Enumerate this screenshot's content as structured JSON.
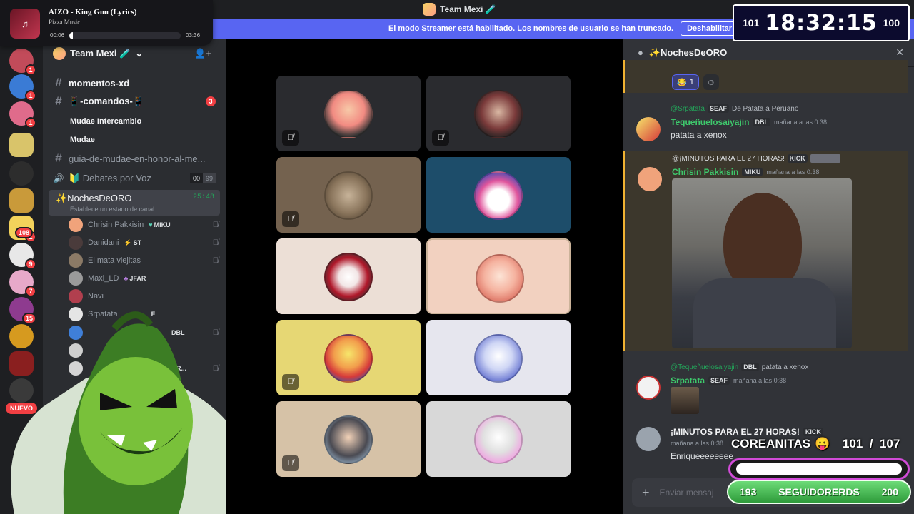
{
  "window": {
    "server_title": "Team Mexi 🧪"
  },
  "banner": {
    "text": "El modo Streamer está habilitado. Los nombres de usuario se han truncado.",
    "button": "Deshabilitar"
  },
  "rail": {
    "badges": [
      "1",
      "1",
      "1",
      "1",
      "108",
      "9",
      "7",
      "15"
    ],
    "new_label": "NUEVO"
  },
  "sidebar": {
    "server_name": "Team Mexi 🧪",
    "channels": [
      {
        "name": "momentos-xd"
      },
      {
        "name": "📱-comandos-📱",
        "count": "3"
      },
      {
        "name": "Mudae Intercambio"
      },
      {
        "name": "Mudae"
      },
      {
        "name": "guia-de-mudae-en-honor-al-me..."
      },
      {
        "name": "🔰 Debates por Voz",
        "count_a": "00",
        "count_b": "99"
      }
    ],
    "active_voice": {
      "name": "✨NochesDeORO",
      "timer": "25:48",
      "status": "Establece un estado de canal"
    },
    "members": [
      {
        "name": "Chrisin Pakkisin",
        "tag": "MIKU"
      },
      {
        "name": "Danidani",
        "tag": "ST"
      },
      {
        "name": "El mata viejitas",
        "tag": ""
      },
      {
        "name": "Maxi_LD",
        "tag": "JFAR"
      },
      {
        "name": "Navi",
        "tag": ""
      },
      {
        "name": "Srpatata",
        "tag": "F"
      },
      {
        "name": "",
        "tag": "DBL"
      },
      {
        "name": "",
        "tag": ""
      },
      {
        "name": "",
        "tag": "OR..."
      }
    ]
  },
  "chat": {
    "channel": "✨NochesDeORO",
    "top_reaction_count": "1",
    "messages": [
      {
        "reply_to": "@Srpatata",
        "reply_tag": "SEAF",
        "reply_text": "De Patata a Peruano",
        "user": "Tequeñuelosaiyajin",
        "tag": "DBL",
        "time": "mañana a las 0:38",
        "text": "patata a xenox"
      },
      {
        "reply_to": "@¡MINUTOS PARA EL 27 HORAS!",
        "reply_tag": "KICK",
        "reply_text": "",
        "user": "Chrisin Pakkisin",
        "tag": "MIKU",
        "time": "mañana a las 0:38",
        "text": ""
      },
      {
        "reply_to": "@Tequeñuelosaiyajin",
        "reply_tag": "DBL",
        "reply_text": "patata a xenox",
        "user": "Srpatata",
        "tag": "SEAF",
        "time": "mañana a las 0:38",
        "text": ""
      },
      {
        "reply_to": "",
        "reply_tag": "",
        "reply_text": "",
        "user": "¡MINUTOS PARA EL 27 HORAS!",
        "tag": "KICK",
        "time": "mañana a las 0:38",
        "text": "Enriqueeeeeeee"
      }
    ],
    "composer_placeholder": "Enviar mensaj"
  },
  "player": {
    "song": "AIZO - King Gnu (Lyrics)",
    "artist": "Pizza Music",
    "elapsed": "00:06",
    "duration": "03:36",
    "progress": 0.03
  },
  "clock": {
    "left": "101",
    "time": "18:32:15",
    "right": "100"
  },
  "goal": {
    "title": "COREANITAS",
    "count": "101  /  107",
    "min": "193",
    "label": "SEGUIDORERDS",
    "max": "200"
  },
  "colors": {
    "accent": "#5865f2",
    "online": "#23a55a",
    "danger": "#f23f43",
    "goal_green": "#3fbf4c"
  }
}
